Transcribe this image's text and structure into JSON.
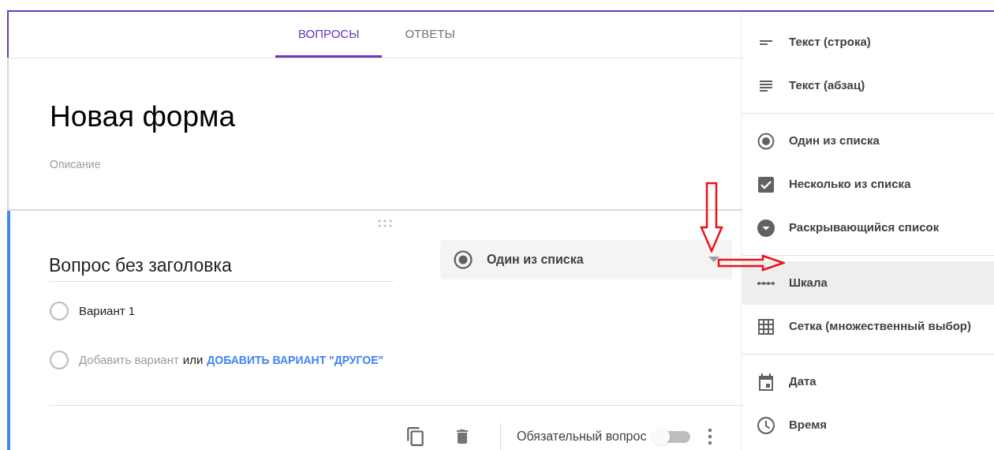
{
  "tabs": [
    {
      "label": "ВОПРОСЫ",
      "selected": true
    },
    {
      "label": "ОТВЕТЫ",
      "selected": false
    }
  ],
  "form": {
    "title": "Новая форма",
    "description_placeholder": "Описание"
  },
  "question": {
    "title": "Вопрос без заголовка",
    "type_label": "Один из списка",
    "options": [
      {
        "label": "Вариант 1",
        "selected": false
      }
    ],
    "add_option": {
      "selected": false,
      "label": "Добавить вариант",
      "separator": "или",
      "other_link": "ДОБАВИТЬ ВАРИАНТ \"ДРУГОЕ\""
    },
    "required": {
      "label": "Обязательный вопрос",
      "on": false
    }
  },
  "type_menu": {
    "groups": [
      [
        {
          "kind": "short",
          "label": "Текст (строка)",
          "selected": false
        },
        {
          "kind": "paragraph",
          "label": "Текст (абзац)",
          "selected": false
        }
      ],
      [
        {
          "kind": "radio",
          "label": "Один из списка",
          "selected": false
        },
        {
          "kind": "checkbox",
          "label": "Несколько из списка",
          "selected": false
        },
        {
          "kind": "dropdown",
          "label": "Раскрывающийся список",
          "selected": false
        }
      ],
      [
        {
          "kind": "scale",
          "label": "Шкала",
          "selected": true
        },
        {
          "kind": "grid",
          "label": "Сетка (множественный выбор)",
          "selected": false
        }
      ],
      [
        {
          "kind": "date",
          "label": "Дата",
          "selected": false
        },
        {
          "kind": "time",
          "label": "Время",
          "selected": false
        }
      ]
    ]
  }
}
